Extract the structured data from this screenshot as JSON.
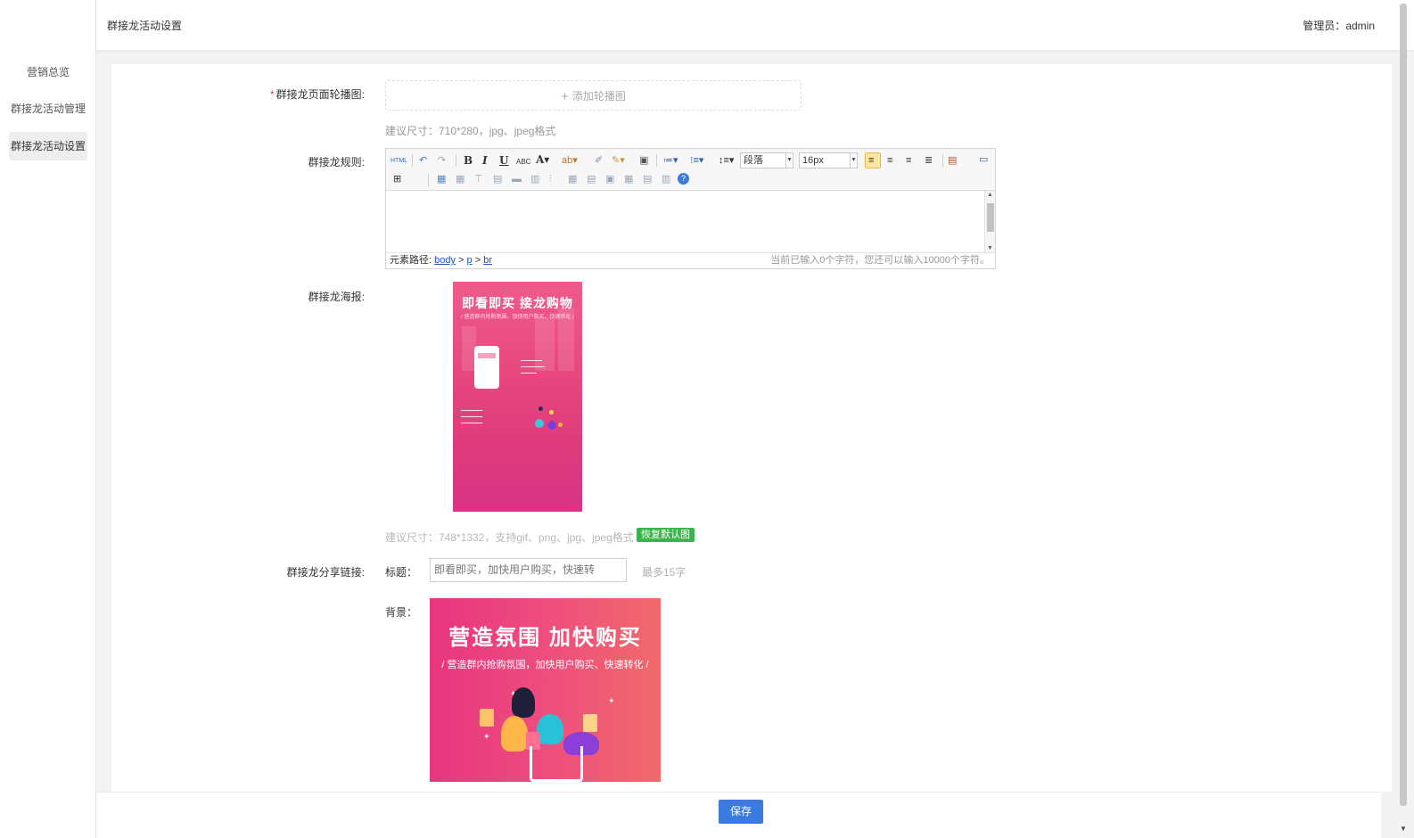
{
  "sidebar": {
    "items": [
      {
        "label": "营销总览"
      },
      {
        "label": "群接龙活动管理"
      },
      {
        "label": "群接龙活动设置"
      }
    ]
  },
  "header": {
    "title": "群接龙活动设置",
    "admin_label": "管理员：",
    "admin_name": "admin"
  },
  "form": {
    "carousel": {
      "required_mark": "*",
      "label": "群接龙页面轮播图:",
      "add_button": "添加轮播图",
      "hint": "建议尺寸：710*280，jpg、jpeg格式"
    },
    "rules": {
      "label": "群接龙规则:",
      "editor": {
        "html_button": "HTML",
        "paragraph_select": "段落",
        "font_size_select": "16px",
        "path_label": "元素路径:",
        "path": [
          "body",
          "p",
          "br"
        ],
        "char_count": "当前已输入0个字符，您还可以输入10000个字符。"
      }
    },
    "poster": {
      "label": "群接龙海报:",
      "image": {
        "title": "即看即买 接龙购物",
        "subtitle": "/ 营造群内抢购氛围，加快用户购买，快速转化 /"
      },
      "hint": "建议尺寸：748*1332，支持gif、png、jpg、jpeg格式",
      "reset_button": "恢复默认图"
    },
    "share": {
      "label": "群接龙分享链接:",
      "title_label": "标题：",
      "title_value": "即看即买，加快用户购买，快速转",
      "title_limit": "最多15字",
      "bg_label": "背景：",
      "bg_image": {
        "title": "营造氛围 加快购买",
        "subtitle": "/ 营造群内抢购氛围，加快用户购买、快速转化 /"
      }
    }
  },
  "footer": {
    "save_button": "保存"
  },
  "colors": {
    "primary": "#3b7be0",
    "success": "#39b54a",
    "required": "#e4393c",
    "poster_pink": "#e84a7f"
  }
}
